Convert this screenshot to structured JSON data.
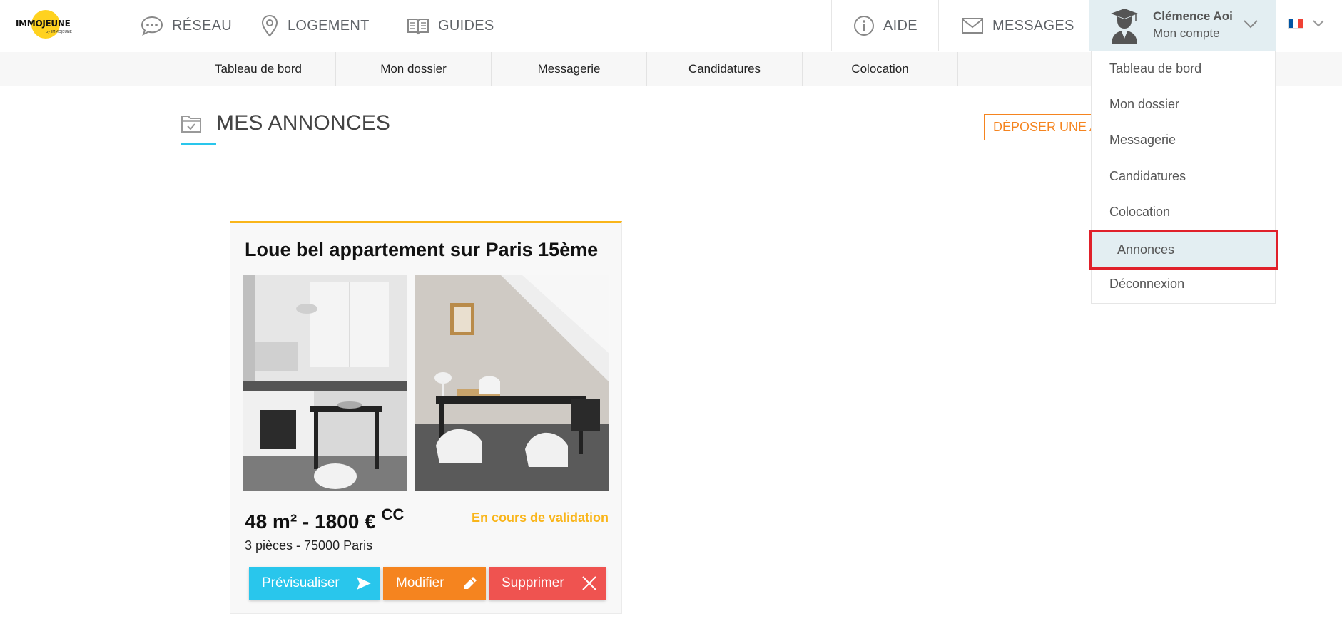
{
  "brand": {
    "logo_text": "IMMOJEUNE",
    "logo_subtext": "by IMMOJEUNE",
    "accent_yellow": "#ffd21f"
  },
  "topnav": {
    "items": [
      {
        "label": "RÉSEAU",
        "icon": "chat-bubble-icon"
      },
      {
        "label": "LOGEMENT",
        "icon": "location-pin-icon"
      },
      {
        "label": "GUIDES",
        "icon": "open-book-icon"
      }
    ],
    "help_label": "AIDE",
    "messages_label": "MESSAGES"
  },
  "account": {
    "name": "Clémence Aoi",
    "subtitle": "Mon compte"
  },
  "language": {
    "current": "fr",
    "flag_colors": [
      "#0055a4",
      "#ffffff",
      "#ef4135"
    ]
  },
  "subnav": {
    "tabs": [
      "Tableau de bord",
      "Mon dossier",
      "Messagerie",
      "Candidatures",
      "Colocation"
    ]
  },
  "page": {
    "title": "MES ANNONCES",
    "deposit_button": "DÉPOSER UNE ANNONCE"
  },
  "listing": {
    "title": "Loue bel appartement sur Paris 15ème",
    "price_main": "48 m² - 1800 €",
    "price_suffix": "CC",
    "status": "En cours de validation",
    "details": "3 pièces - 75000 Paris",
    "buttons": {
      "preview": "Prévisualiser",
      "edit": "Modifier",
      "delete": "Supprimer"
    }
  },
  "dropdown": {
    "items": [
      "Tableau de bord",
      "Mon dossier",
      "Messagerie",
      "Candidatures",
      "Colocation",
      "Annonces",
      "Déconnexion"
    ],
    "highlighted": "Annonces"
  },
  "colors": {
    "cyan": "#29c6ec",
    "orange": "#f5841f",
    "red": "#ef5350",
    "status_yellow": "#f9b51a",
    "highlight_border": "#e0202a"
  }
}
